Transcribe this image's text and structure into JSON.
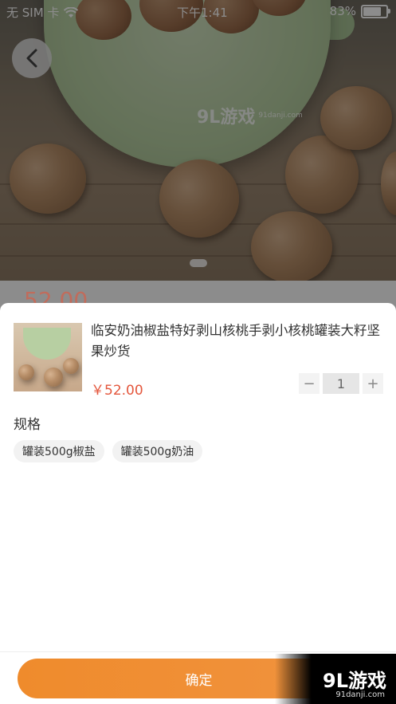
{
  "status_bar": {
    "carrier": "无 SIM 卡",
    "time": "下午1:41",
    "battery": "83%"
  },
  "hero": {
    "watermark_text": "9L游戏",
    "watermark_sub": "91danji.com",
    "behind_price": "52.00"
  },
  "product": {
    "title": "临安奶油椒盐特好剥山核桃手剥小核桃罐装大籽坚果炒货",
    "price": "￥52.00",
    "quantity": "1",
    "minus": "−",
    "plus": "+"
  },
  "spec": {
    "label": "规格",
    "options": [
      "罐装500g椒盐",
      "罐装500g奶油"
    ]
  },
  "footer": {
    "confirm_label": "确定",
    "badge_text": "9L游戏",
    "badge_sub": "91danji.com"
  },
  "colors": {
    "accent": "#f0913a",
    "price": "#e4573d"
  }
}
